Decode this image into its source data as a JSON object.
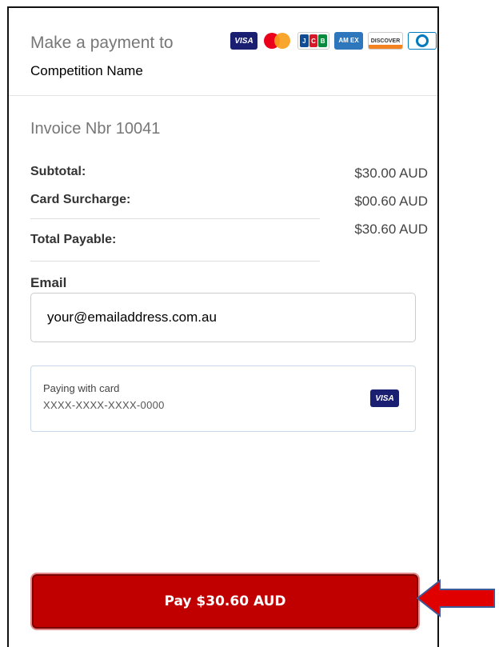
{
  "header": {
    "title": "Make a payment to",
    "competition": "Competition Name",
    "card_logos": [
      {
        "name": "visa",
        "label": "VISA"
      },
      {
        "name": "mastercard",
        "label": ""
      },
      {
        "name": "jcb",
        "label": "JCB"
      },
      {
        "name": "amex",
        "label": "AM EX"
      },
      {
        "name": "discover",
        "label": "DISCOVER"
      },
      {
        "name": "diners",
        "label": ""
      }
    ]
  },
  "invoice": {
    "title": "Invoice Nbr 10041",
    "rows": [
      {
        "label": "Subtotal:",
        "value": "$30.00  AUD"
      },
      {
        "label": "Card Surcharge:",
        "value": "$00.60  AUD"
      },
      {
        "label": "Total Payable:",
        "value": "$30.60  AUD"
      }
    ]
  },
  "email": {
    "label": "Email",
    "value": "your@emailaddress.com.au"
  },
  "card": {
    "paying_label": "Paying with card",
    "number": "XXXX-XXXX-XXXX-0000",
    "brand": "VISA"
  },
  "pay_button": {
    "label": "Pay $30.60 AUD"
  },
  "colors": {
    "pay_button_bg": "#c00000",
    "arrow": "#e00000"
  },
  "annotation": {
    "arrow_icon": "left-arrow-icon"
  }
}
